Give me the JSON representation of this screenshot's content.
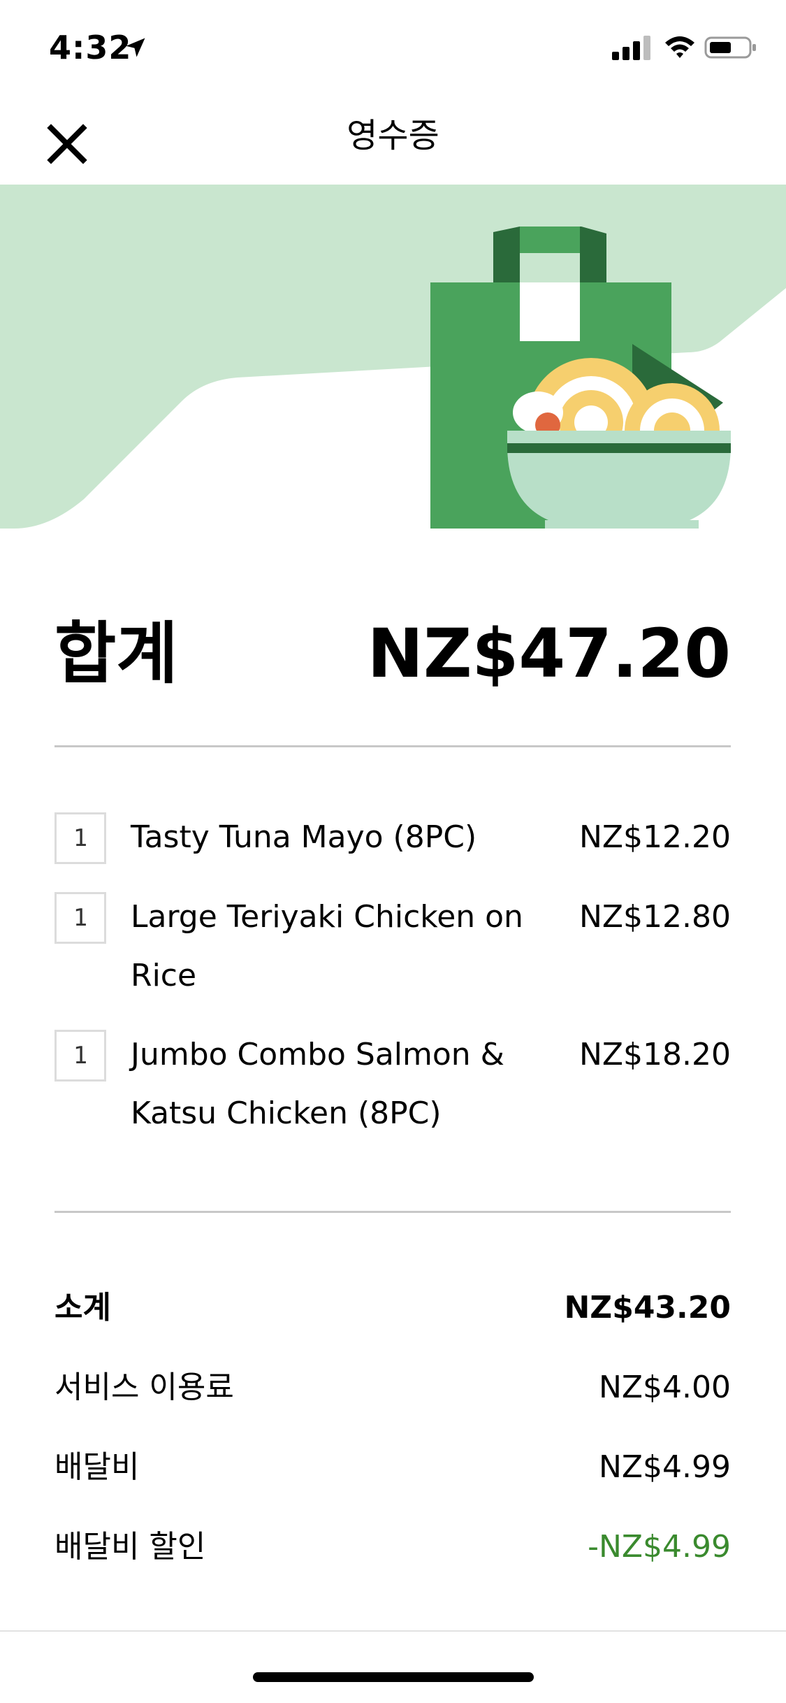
{
  "status_bar": {
    "time": "4:32"
  },
  "header": {
    "title": "영수증"
  },
  "total": {
    "label": "합계",
    "value": "NZ$47.20"
  },
  "items": [
    {
      "qty": "1",
      "name": "Tasty Tuna Mayo (8PC)",
      "price": "NZ$12.20"
    },
    {
      "qty": "1",
      "name": "Large Teriyaki Chicken on Rice",
      "price": "NZ$12.80"
    },
    {
      "qty": "1",
      "name": "Jumbo Combo Salmon & Katsu Chicken (8PC)",
      "price": "NZ$18.20"
    }
  ],
  "summary": {
    "subtotal_label": "소계",
    "subtotal_value": "NZ$43.20",
    "service_fee_label": "서비스 이용료",
    "service_fee_value": "NZ$4.00",
    "delivery_fee_label": "배달비",
    "delivery_fee_value": "NZ$4.99",
    "delivery_discount_label": "배달비 할인",
    "delivery_discount_value": "-NZ$4.99"
  },
  "colors": {
    "discount": "#3a8a2e",
    "hero_bg": "#c9e6cf",
    "bag_green": "#4aa35c",
    "bag_dark": "#2a6a3a",
    "bowl": "#b8dfc8",
    "noodle": "#f6cf6e"
  },
  "icons": {
    "close": "close-icon",
    "location": "location-arrow-icon",
    "signal": "cellular-signal-icon",
    "wifi": "wifi-icon",
    "battery": "battery-icon"
  }
}
